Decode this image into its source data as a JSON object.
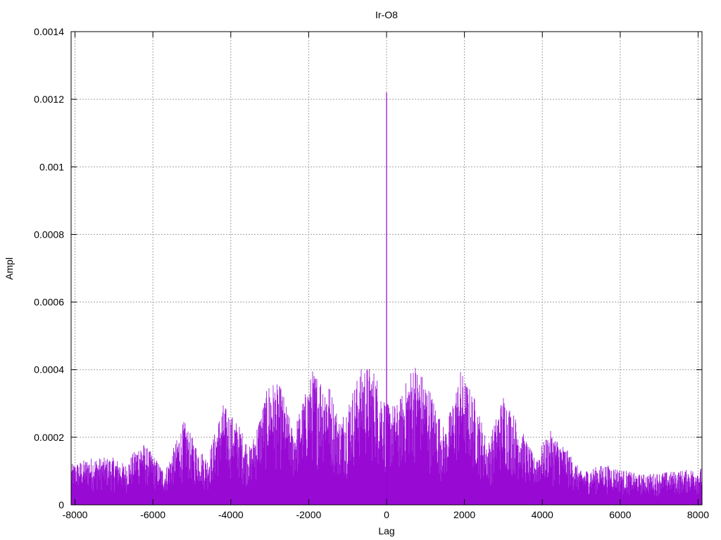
{
  "chart_data": {
    "type": "bar",
    "title": "Ir-O8",
    "xlabel": "Lag",
    "ylabel": "Ampl",
    "xlim": [
      -8100,
      8100
    ],
    "ylim": [
      0,
      0.0014
    ],
    "xticks": [
      -8000,
      -6000,
      -4000,
      -2000,
      0,
      2000,
      4000,
      6000,
      8000
    ],
    "xtick_labels": [
      "-8000",
      "-6000",
      "-4000",
      "-2000",
      "0",
      "2000",
      "4000",
      "6000",
      "8000"
    ],
    "yticks": [
      0,
      0.0002,
      0.0004,
      0.0006,
      0.0008,
      0.001,
      0.0012,
      0.0014
    ],
    "ytick_labels": [
      "0",
      "0.0002",
      "0.0004",
      "0.0006",
      "0.0008",
      "0.001",
      "0.0012",
      "0.0014"
    ],
    "grid": true,
    "series_color": "#9400d3",
    "envelope": [
      {
        "lag": -8100,
        "ampl": 0.00012
      },
      {
        "lag": -7600,
        "ampl": 0.00014
      },
      {
        "lag": -7000,
        "ampl": 0.00014
      },
      {
        "lag": -6700,
        "ampl": 0.00012
      },
      {
        "lag": -6300,
        "ampl": 0.00019
      },
      {
        "lag": -6000,
        "ampl": 0.00015
      },
      {
        "lag": -5700,
        "ampl": 0.0001
      },
      {
        "lag": -5200,
        "ampl": 0.00025
      },
      {
        "lag": -4900,
        "ampl": 0.00018
      },
      {
        "lag": -4600,
        "ampl": 0.00014
      },
      {
        "lag": -4200,
        "ampl": 0.0003
      },
      {
        "lag": -3800,
        "ampl": 0.00024
      },
      {
        "lag": -3500,
        "ampl": 0.00017
      },
      {
        "lag": -3000,
        "ampl": 0.00037
      },
      {
        "lag": -2700,
        "ampl": 0.00035
      },
      {
        "lag": -2400,
        "ampl": 0.00022
      },
      {
        "lag": -1900,
        "ampl": 0.0004
      },
      {
        "lag": -1500,
        "ampl": 0.00037
      },
      {
        "lag": -1200,
        "ampl": 0.00025
      },
      {
        "lag": -600,
        "ampl": 0.00042
      },
      {
        "lag": -300,
        "ampl": 0.0004
      },
      {
        "lag": 0,
        "ampl": 0.0003
      },
      {
        "lag": 300,
        "ampl": 0.0003
      },
      {
        "lag": 700,
        "ampl": 0.00043
      },
      {
        "lag": 1100,
        "ampl": 0.00035
      },
      {
        "lag": 1500,
        "ampl": 0.00022
      },
      {
        "lag": 1900,
        "ampl": 0.0004
      },
      {
        "lag": 2300,
        "ampl": 0.00031
      },
      {
        "lag": 2600,
        "ampl": 0.00018
      },
      {
        "lag": 3000,
        "ampl": 0.00033
      },
      {
        "lag": 3400,
        "ampl": 0.00024
      },
      {
        "lag": 3800,
        "ampl": 0.00014
      },
      {
        "lag": 4200,
        "ampl": 0.00022
      },
      {
        "lag": 4600,
        "ampl": 0.00017
      },
      {
        "lag": 5000,
        "ampl": 0.0001
      },
      {
        "lag": 5600,
        "ampl": 0.00012
      },
      {
        "lag": 6500,
        "ampl": 9e-05
      },
      {
        "lag": 7400,
        "ampl": 0.0001
      },
      {
        "lag": 8100,
        "ampl": 0.00011
      }
    ],
    "peak": {
      "lag": 0,
      "ampl": 0.00122
    }
  }
}
